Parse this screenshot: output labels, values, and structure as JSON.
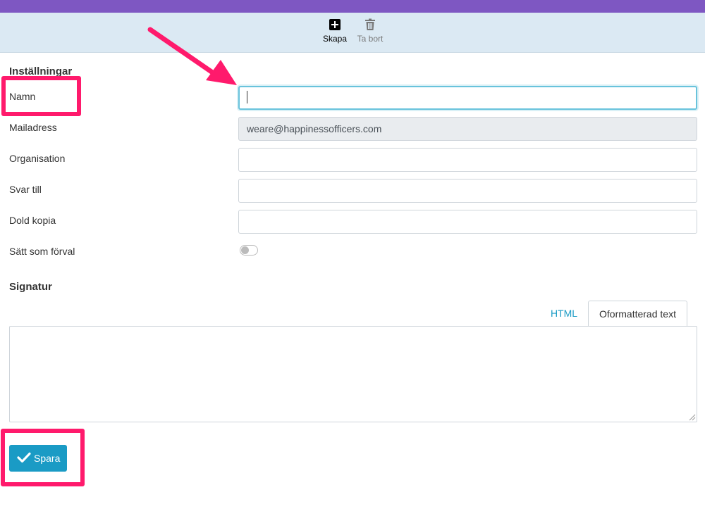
{
  "toolbar": {
    "create_label": "Skapa",
    "delete_label": "Ta bort"
  },
  "settings": {
    "title": "Inställningar",
    "fields": [
      {
        "label": "Namn",
        "value": "",
        "state": "focused"
      },
      {
        "label": "Mailadress",
        "value": "weare@happinessofficers.com",
        "state": "disabled"
      },
      {
        "label": "Organisation",
        "value": ""
      },
      {
        "label": "Svar till",
        "value": ""
      },
      {
        "label": "Dold kopia",
        "value": ""
      }
    ],
    "default_toggle": {
      "label": "Sätt som förval",
      "checked": false
    }
  },
  "signature": {
    "title": "Signatur",
    "tabs": [
      "HTML",
      "Oformatterad text"
    ],
    "active_tab": "Oformatterad text",
    "value": ""
  },
  "save_button": {
    "label": "Spara"
  },
  "colors": {
    "topbar": "#7e57c2",
    "toolbar_bg": "#dbe9f3",
    "accent": "#1a9bc5",
    "annotation": "#ff1a6c"
  },
  "icons": [
    "plus-square-icon",
    "trash-icon",
    "check-icon",
    "arrow-annotation"
  ]
}
